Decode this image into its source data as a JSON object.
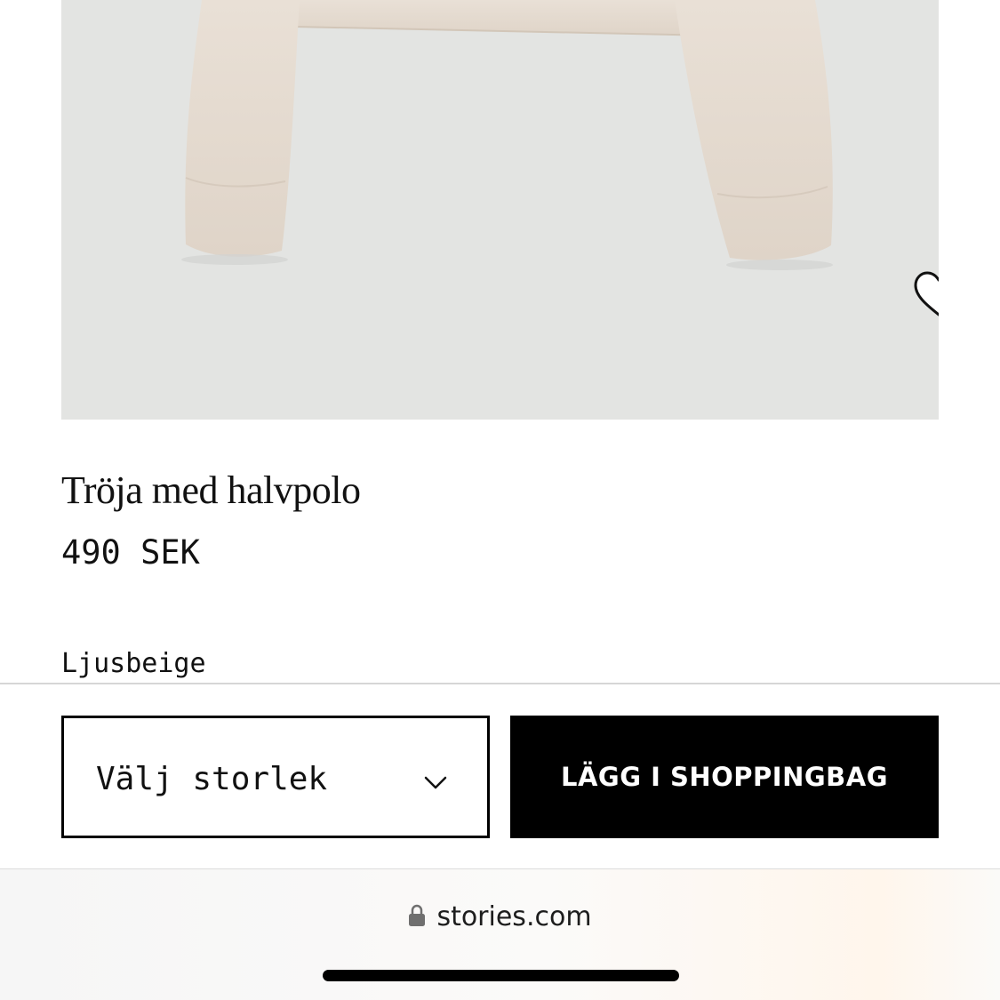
{
  "product": {
    "title": "Tröja med halvpolo",
    "price": "490 SEK",
    "color_name": "Ljusbeige"
  },
  "actions": {
    "size_select_label": "Välj storlek",
    "add_to_bag_label": "LÄGG I SHOPPINGBAG"
  },
  "browser": {
    "url": "stories.com"
  },
  "icons": {
    "wishlist": "heart-outline-icon",
    "dropdown": "chevron-down-icon",
    "secure": "lock-icon"
  },
  "colors": {
    "button_bg": "#000000",
    "image_bg": "#e3e4e2",
    "garment": "#e6dcd1"
  }
}
